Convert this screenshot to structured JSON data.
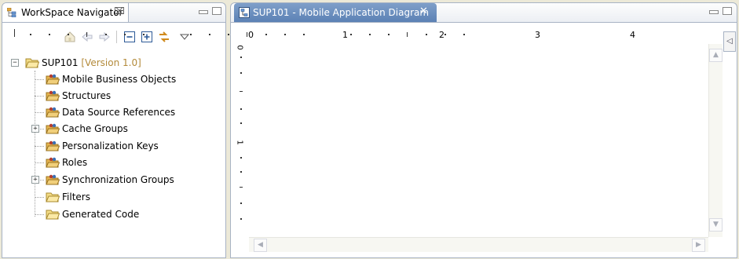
{
  "navigator": {
    "title": "WorkSpace Navigator",
    "close_glyph": "⌧",
    "toolbar_icons": [
      "home-icon",
      "back-icon",
      "forward-icon",
      "collapse-all-icon",
      "expand-all-icon",
      "link-with-editor-icon",
      "view-menu-icon"
    ],
    "tree": {
      "root": {
        "label": "SUP101",
        "version": "[Version 1.0]",
        "expander": "−"
      },
      "items": [
        {
          "label": "Mobile Business Objects",
          "expander": ""
        },
        {
          "label": "Structures",
          "expander": ""
        },
        {
          "label": "Data Source References",
          "expander": ""
        },
        {
          "label": "Cache Groups",
          "expander": "+"
        },
        {
          "label": "Personalization Keys",
          "expander": ""
        },
        {
          "label": "Roles",
          "expander": ""
        },
        {
          "label": "Synchronization Groups",
          "expander": "+"
        },
        {
          "label": "Filters",
          "expander": ""
        },
        {
          "label": "Generated Code",
          "expander": ""
        }
      ]
    }
  },
  "editor": {
    "tab_title": "SUP101 - Mobile Application Diagram",
    "tab_close": "✕",
    "ruler_top_numbers": [
      "0",
      "1",
      "2",
      "3",
      "4"
    ],
    "ruler_left_numbers": [
      "0",
      "1"
    ],
    "palette_toggle": "◁"
  },
  "colors": {
    "chrome": "#ece9d8",
    "active_tab": "#6a8cbd",
    "panel_border": "#a8b3c4",
    "version_text": "#b38a3a"
  }
}
